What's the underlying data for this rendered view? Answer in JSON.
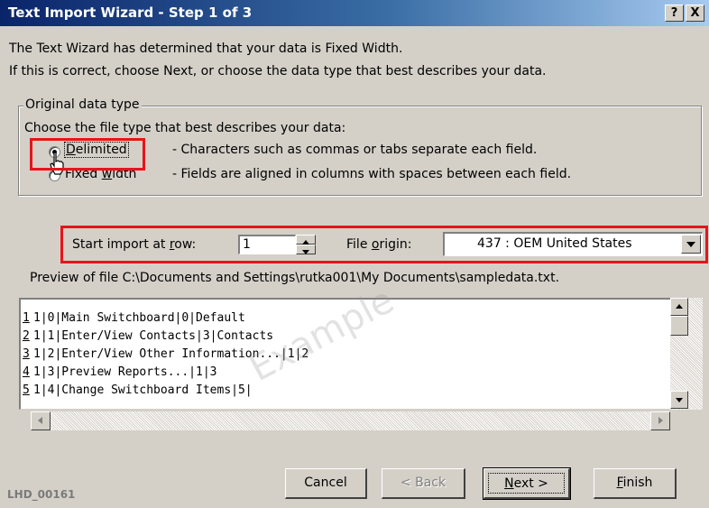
{
  "window": {
    "title": "Text Import Wizard - Step 1 of 3",
    "help_button": "?",
    "close_button": "X"
  },
  "intro": {
    "line1": "The Text Wizard has determined that your data is Fixed Width.",
    "line2": "If this is correct, choose Next, or choose the data type that best describes your data."
  },
  "original_data_type": {
    "legend": "Original data type",
    "prompt": "Choose the file type that best describes your data:",
    "options": [
      {
        "label_pre": "",
        "label_accel": "D",
        "label_post": "elimited",
        "description": "- Characters such as commas or tabs separate each field.",
        "selected": true
      },
      {
        "label_pre": "Fixed ",
        "label_accel": "w",
        "label_post": "idth",
        "description": "- Fields are aligned in columns with spaces between each field.",
        "selected": false
      }
    ]
  },
  "start_import": {
    "label_pre": "Start import at ",
    "label_accel": "r",
    "label_post": "ow:",
    "value": "1"
  },
  "file_origin": {
    "label_pre": "File ",
    "label_accel": "o",
    "label_post": "rigin:",
    "value": "437 : OEM United States"
  },
  "preview": {
    "label": "Preview of file C:\\Documents and Settings\\rutka001\\My Documents\\sampledata.txt.",
    "rows": [
      {
        "num": "1",
        "text": "1|0|Main Switchboard|0|Default"
      },
      {
        "num": "2",
        "text": "1|1|Enter/View Contacts|3|Contacts"
      },
      {
        "num": "3",
        "text": "1|2|Enter/View Other Information...|1|2"
      },
      {
        "num": "4",
        "text": "1|3|Preview Reports...|1|3"
      },
      {
        "num": "5",
        "text": "1|4|Change Switchboard Items|5|"
      }
    ],
    "watermark": "Example"
  },
  "buttons": {
    "cancel": "Cancel",
    "back": "< Back",
    "next_accel": "N",
    "next_post": "ext >",
    "finish_accel": "F",
    "finish_post": "inish"
  },
  "image_id": "LHD_00161",
  "colors": {
    "title_bar_start": "#0a246a",
    "title_bar_end": "#a6caf0",
    "face": "#d4d0c8",
    "highlight_box": "#e8141b"
  }
}
